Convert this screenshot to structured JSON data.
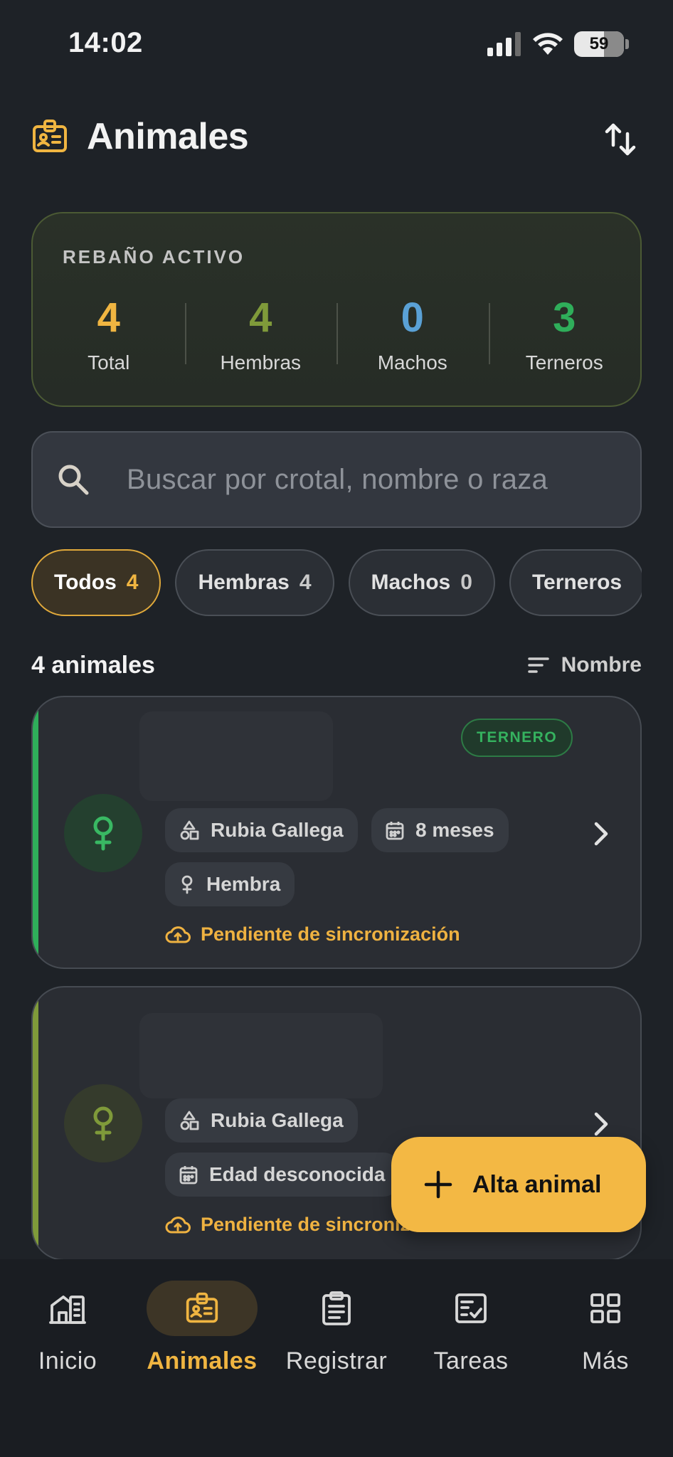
{
  "status_bar": {
    "time": "14:02",
    "battery": "59"
  },
  "header": {
    "title": "Animales",
    "title_icon": "badge-icon",
    "sort_icon": "swap-vertical-icon"
  },
  "herd": {
    "title": "REBAÑO ACTIVO",
    "stats": [
      {
        "value": "4",
        "label": "Total",
        "color": "#f0b541"
      },
      {
        "value": "4",
        "label": "Hembras",
        "color": "#7f9a3a"
      },
      {
        "value": "0",
        "label": "Machos",
        "color": "#5aa1d6"
      },
      {
        "value": "3",
        "label": "Terneros",
        "color": "#2fae5a"
      }
    ]
  },
  "search": {
    "placeholder": "Buscar por crotal, nombre o raza"
  },
  "filters": [
    {
      "label": "Todos",
      "count": "4",
      "active": true
    },
    {
      "label": "Hembras",
      "count": "4",
      "active": false
    },
    {
      "label": "Machos",
      "count": "0",
      "active": false
    },
    {
      "label": "Terneros",
      "count": "",
      "active": false
    }
  ],
  "list": {
    "count_label": "4 animales",
    "sort_label": "Nombre"
  },
  "animals": [
    {
      "accent": "#2fae5a",
      "badge": "TERNERO",
      "breed": "Rubia Gallega",
      "age": "8 meses",
      "sex": "Hembra",
      "sync": "Pendiente de sincronización"
    },
    {
      "accent": "#7f9a3a",
      "breed": "Rubia Gallega",
      "age": "Edad desconocida",
      "sync": "Pendiente de sincronización"
    }
  ],
  "fab": {
    "label": "Alta animal"
  },
  "nav": [
    {
      "label": "Inicio",
      "icon": "home-icon",
      "active": false
    },
    {
      "label": "Animales",
      "icon": "badge-icon",
      "active": true
    },
    {
      "label": "Registrar",
      "icon": "clipboard-icon",
      "active": false
    },
    {
      "label": "Tareas",
      "icon": "task-check-icon",
      "active": false
    },
    {
      "label": "Más",
      "icon": "grid-icon",
      "active": false
    }
  ]
}
